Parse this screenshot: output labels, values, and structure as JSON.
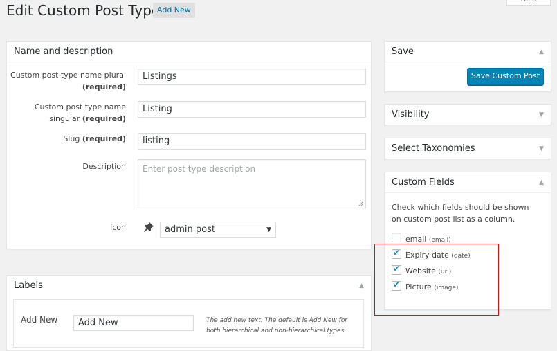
{
  "page": {
    "title": "Edit Custom Post Type",
    "add_new_label": "Add New",
    "help_label": "Help"
  },
  "name_description": {
    "heading": "Name and description",
    "plural_label": "Custom post type name plural",
    "singular_label": "Custom post type name singular",
    "slug_label": "Slug",
    "required_text": "(required)",
    "description_label": "Description",
    "icon_label": "Icon",
    "plural_value": "Listings",
    "singular_value": "Listing",
    "slug_value": "listing",
    "description_placeholder": "Enter post type description",
    "icon_value": "admin post",
    "icon_glyph": "pushpin-icon"
  },
  "labels_box": {
    "heading": "Labels",
    "add_new_label": "Add New",
    "add_new_value": "Add New",
    "add_new_hint": "The add new text. The default is Add New for both hierarchical and non-hierarchical types."
  },
  "sidebar": {
    "save": {
      "heading": "Save",
      "button": "Save Custom Post"
    },
    "visibility": {
      "heading": "Visibility"
    },
    "taxonomies": {
      "heading": "Select Taxonomies"
    },
    "custom_fields": {
      "heading": "Custom Fields",
      "intro": "Check which fields should be shown on custom post list as a column.",
      "fields": [
        {
          "label": "email",
          "type": "(email)",
          "checked": false
        },
        {
          "label": "Expiry date",
          "type": "(date)",
          "checked": true
        },
        {
          "label": "Website",
          "type": "(url)",
          "checked": true
        },
        {
          "label": "Picture",
          "type": "(image)",
          "checked": true
        }
      ]
    }
  },
  "colors": {
    "primary_button": "#0085ba",
    "checkmark": "#1e8cbe",
    "highlight_outline": "#dd1111",
    "background": "#f1f1f1"
  }
}
